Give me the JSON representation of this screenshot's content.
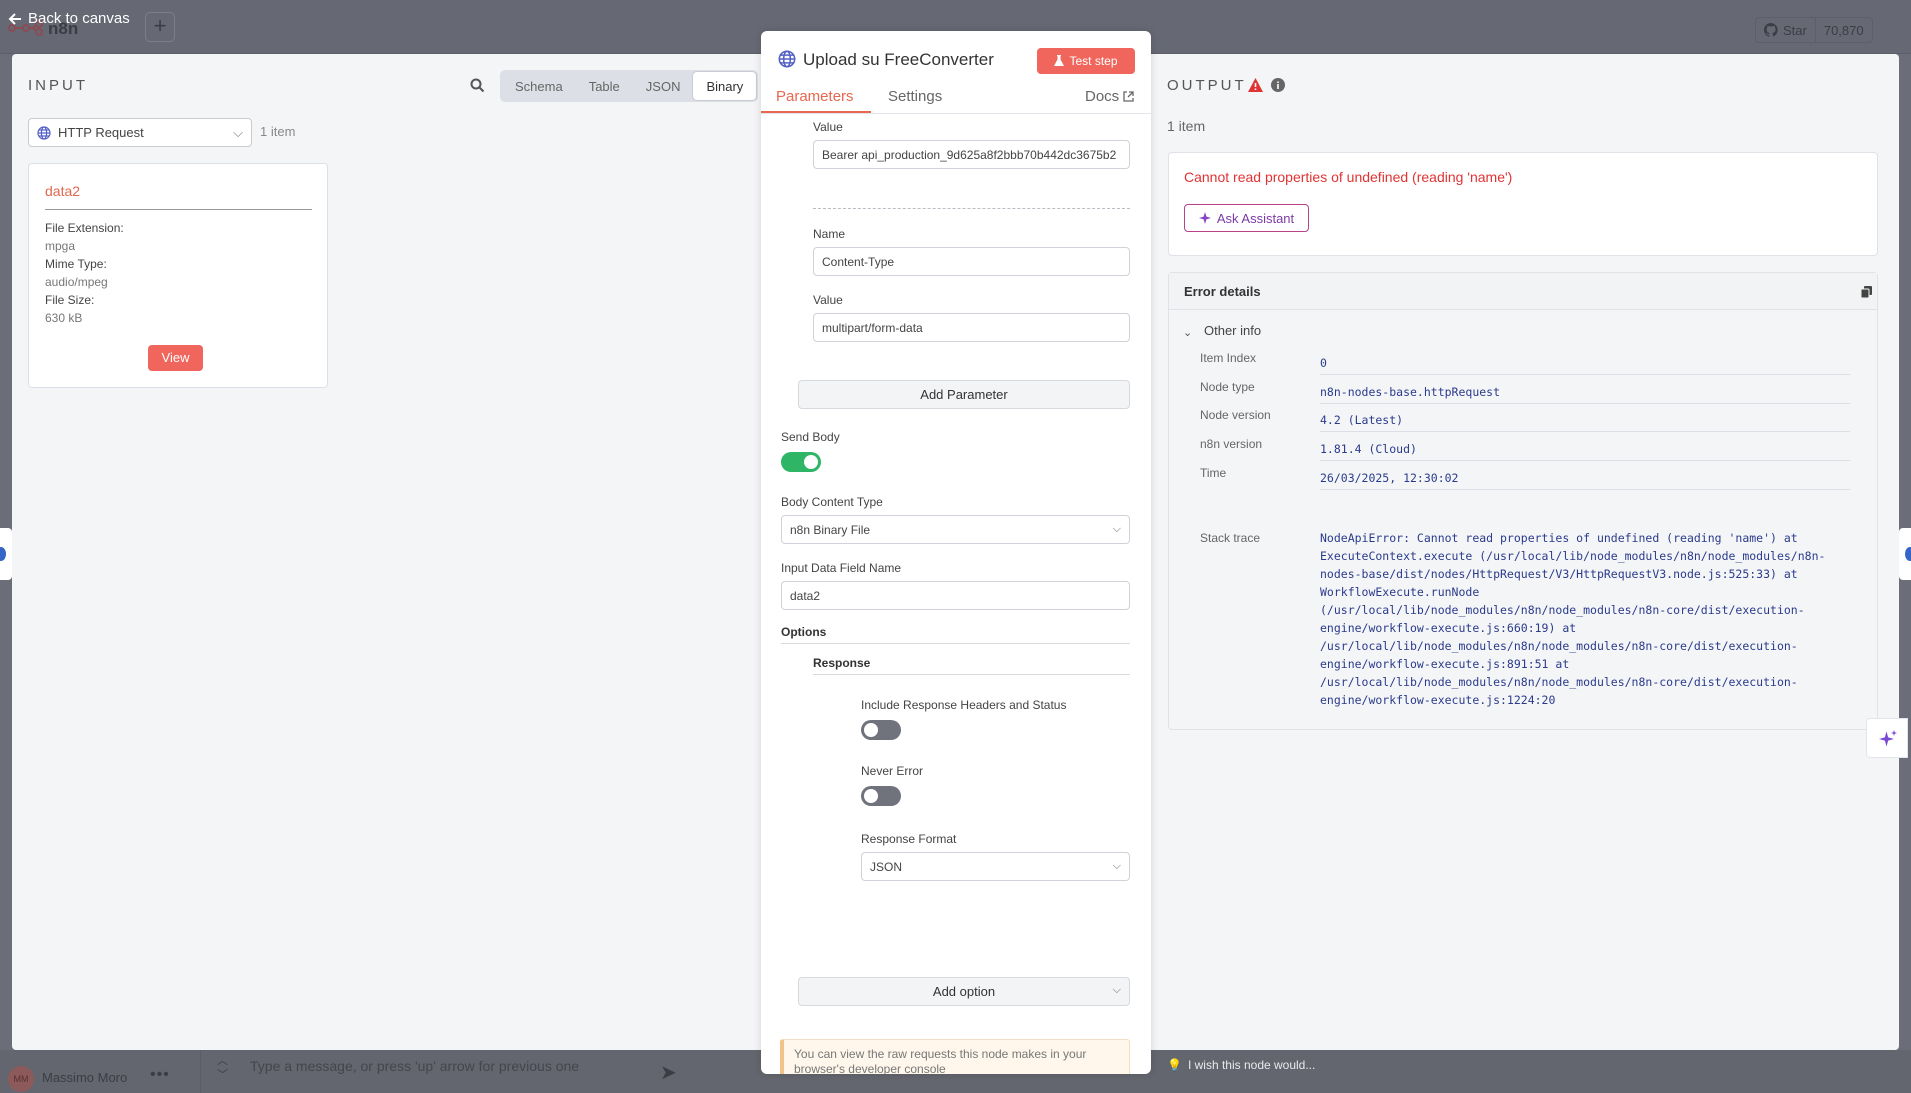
{
  "background": {
    "app_name": "n8n",
    "github": {
      "star_label": "Star",
      "count": "70,870"
    },
    "user": {
      "initials": "MM",
      "name": "Massimo Moro"
    },
    "chat": {
      "placeholder": "Type a message, or press 'up' arrow for previous one"
    },
    "wish_text": "I wish this node would..."
  },
  "nav": {
    "back_label": "Back to canvas"
  },
  "input_panel": {
    "title": "INPUT",
    "tabs": [
      "Schema",
      "Table",
      "JSON",
      "Binary"
    ],
    "active_tab": "Binary",
    "node_select": "HTTP Request",
    "item_count": "1 item",
    "binary_item": {
      "name": "data2",
      "fields": [
        {
          "label": "File Extension:",
          "value": "mpga"
        },
        {
          "label": "Mime Type:",
          "value": "audio/mpeg"
        },
        {
          "label": "File Size:",
          "value": "630 kB"
        }
      ],
      "view_label": "View"
    }
  },
  "node_panel": {
    "title": "Upload su FreeConverter",
    "test_label": "Test step",
    "tabs": {
      "parameters": "Parameters",
      "settings": "Settings",
      "docs": "Docs"
    },
    "header_param1": {
      "value_label": "Value",
      "value": "Bearer api_production_9d625a8f2bbb70b442dc3675b2"
    },
    "header_param2": {
      "name_label": "Name",
      "name_value": "Content-Type",
      "value_label": "Value",
      "value": "multipart/form-data"
    },
    "add_parameter_label": "Add Parameter",
    "send_body": {
      "label": "Send Body",
      "on": true
    },
    "body_content_type": {
      "label": "Body Content Type",
      "value": "n8n Binary File"
    },
    "input_field": {
      "label": "Input Data Field Name",
      "value": "data2"
    },
    "options_label": "Options",
    "response_label": "Response",
    "include_headers": {
      "label": "Include Response Headers and Status",
      "on": false
    },
    "never_error": {
      "label": "Never Error",
      "on": false
    },
    "response_format": {
      "label": "Response Format",
      "value": "JSON"
    },
    "add_option_label": "Add option",
    "notice": "You can view the raw requests this node makes in your browser's developer console"
  },
  "output_panel": {
    "title": "OUTPUT",
    "item_count": "1 item",
    "error_title": "Cannot read properties of undefined (reading 'name')",
    "ask_label": "Ask Assistant",
    "details_title": "Error details",
    "other_info_label": "Other info",
    "details": [
      {
        "key": "Item Index",
        "value": "0"
      },
      {
        "key": "Node type",
        "value": "n8n-nodes-base.httpRequest"
      },
      {
        "key": "Node version",
        "value": "4.2 (Latest)"
      },
      {
        "key": "n8n version",
        "value": "1.81.4 (Cloud)"
      },
      {
        "key": "Time",
        "value": "26/03/2025, 12:30:02"
      }
    ],
    "stack_label": "Stack trace",
    "stack_lines": [
      "NodeApiError: Cannot read properties of undefined (reading 'name') at",
      "ExecuteContext.execute (/usr/local/lib/node_modules/n8n/node_modules/n8n-",
      "nodes-base/dist/nodes/HttpRequest/V3/HttpRequestV3.node.js:525:33) at",
      "WorkflowExecute.runNode",
      "(/usr/local/lib/node_modules/n8n/node_modules/n8n-core/dist/execution-",
      "engine/workflow-execute.js:660:19) at",
      "/usr/local/lib/node_modules/n8n/node_modules/n8n-core/dist/execution-",
      "engine/workflow-execute.js:891:51 at",
      "/usr/local/lib/node_modules/n8n/node_modules/n8n-core/dist/execution-",
      "engine/workflow-execute.js:1224:20"
    ]
  }
}
